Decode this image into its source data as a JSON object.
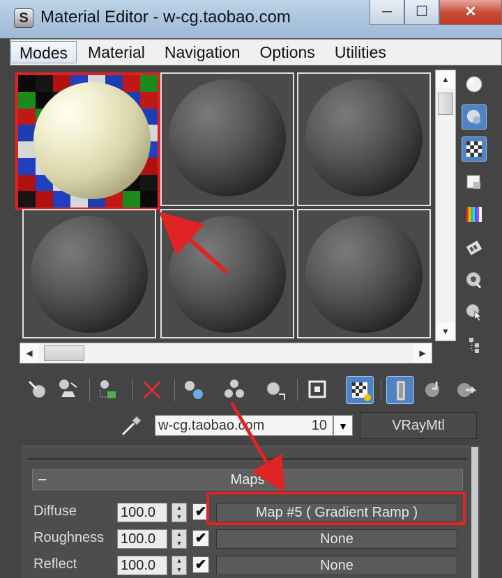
{
  "window": {
    "title": "Material Editor - w-cg.taobao.com",
    "app_icon_glyph": "S",
    "minimize_glyph": "─",
    "maximize_glyph": "☐",
    "close_glyph": "✕"
  },
  "menu": {
    "items": [
      "Modes",
      "Material",
      "Navigation",
      "Options",
      "Utilities"
    ],
    "active": "Modes"
  },
  "slots": {
    "count": 6,
    "selected_index": 0
  },
  "material": {
    "name": "w-cg.taobao.com",
    "slot_number": "10",
    "type": "VRayMtl"
  },
  "maps": {
    "title": "Maps",
    "collapse_glyph": "–",
    "rows": [
      {
        "label": "Diffuse",
        "amount": "100.0",
        "checked": "✔",
        "map": "Map #5  ( Gradient Ramp )"
      },
      {
        "label": "Roughness",
        "amount": "100.0",
        "checked": "✔",
        "map": "None"
      },
      {
        "label": "Reflect",
        "amount": "100.0",
        "checked": "✔",
        "map": "None"
      }
    ]
  },
  "colors": {
    "annotation_red": "#e02424",
    "active_tool_blue": "#4f84c4",
    "titlebar_blue": "#a9c3dd"
  },
  "icons": {
    "sidebar": [
      "sample-type-icon",
      "backlight-icon",
      "background-icon",
      "sample-uv-tiling-icon",
      "video-color-check-icon",
      "make-preview-icon",
      "options-icon",
      "select-by-material-icon",
      "material-map-navigator-icon"
    ],
    "toolbar": [
      "get-material-icon",
      "put-material-to-scene-icon",
      "assign-material-to-selection-icon",
      "reset-map-icon",
      "make-material-copy-icon",
      "make-unique-icon",
      "put-to-library-icon",
      "material-id-channel-icon",
      "show-shaded-in-viewport-icon",
      "show-end-result-icon",
      "go-to-parent-icon",
      "go-forward-to-sibling-icon"
    ]
  }
}
